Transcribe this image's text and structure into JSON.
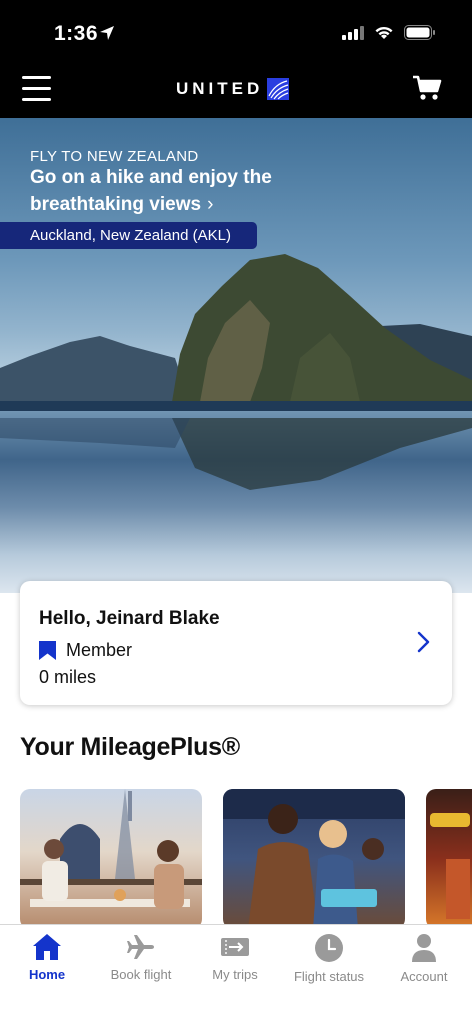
{
  "status_bar": {
    "time": "1:36"
  },
  "header": {
    "logo_text": "UNITED"
  },
  "hero": {
    "eyebrow": "FLY TO NEW ZEALAND",
    "headline": "Go on a hike and enjoy the breathtaking views",
    "location_tag": "Auckland, New Zealand (AKL)"
  },
  "member_card": {
    "greeting": "Hello, Jeinard Blake",
    "tier": "Member",
    "miles": "0 miles"
  },
  "section": {
    "title": "Your MileagePlus®"
  },
  "tabs": [
    {
      "label": "Home",
      "icon": "home-icon",
      "active": true
    },
    {
      "label": "Book flight",
      "icon": "airplane-icon",
      "active": false
    },
    {
      "label": "My trips",
      "icon": "ticket-icon",
      "active": false
    },
    {
      "label": "Flight status",
      "icon": "clock-icon",
      "active": false
    },
    {
      "label": "Account",
      "icon": "person-icon",
      "active": false
    }
  ],
  "colors": {
    "brand_blue": "#1434cb",
    "tag_blue": "#16277a",
    "inactive_tab": "#8a8a8a"
  }
}
